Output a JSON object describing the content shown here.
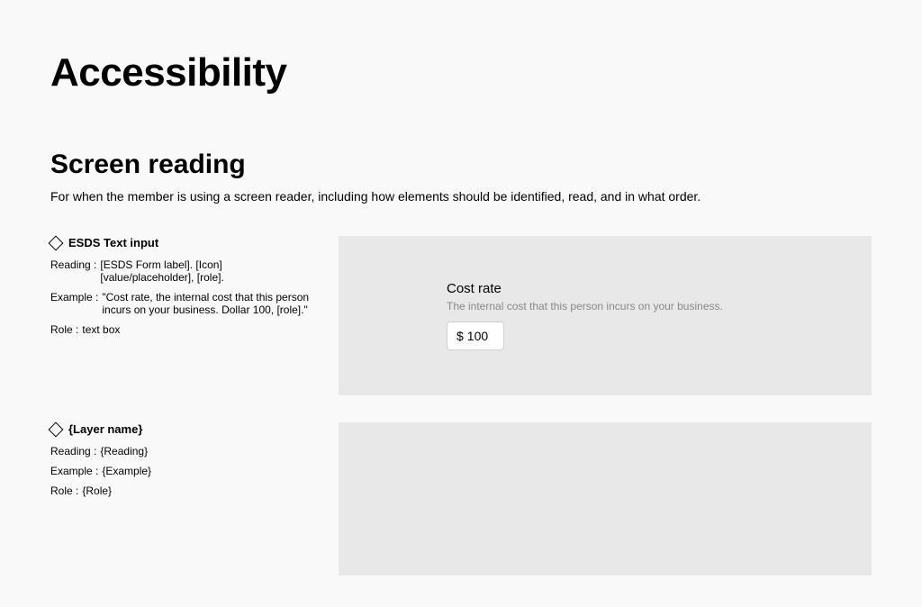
{
  "page": {
    "title": "Accessibility"
  },
  "section": {
    "title": "Screen reading",
    "description": "For when the member is using a screen reader, including how elements should be identified, read, and in what order."
  },
  "entries": [
    {
      "name": "ESDS Text input",
      "reading_label": "Reading :",
      "reading": "[ESDS Form label]. [Icon] [value/placeholder], [role].",
      "example_label": "Example :",
      "example": "\"Cost rate, the internal cost that this person incurs on your business. Dollar 100, [role].\"",
      "role_label": "Role :",
      "role": "text box",
      "preview": {
        "label": "Cost rate",
        "help": "The internal cost that this person incurs on your business.",
        "prefix": "$",
        "value": "100"
      }
    },
    {
      "name": "{Layer name}",
      "reading_label": "Reading :",
      "reading": "{Reading}",
      "example_label": "Example :",
      "example": "{Example}",
      "role_label": "Role :",
      "role": "{Role}",
      "preview": null
    }
  ]
}
